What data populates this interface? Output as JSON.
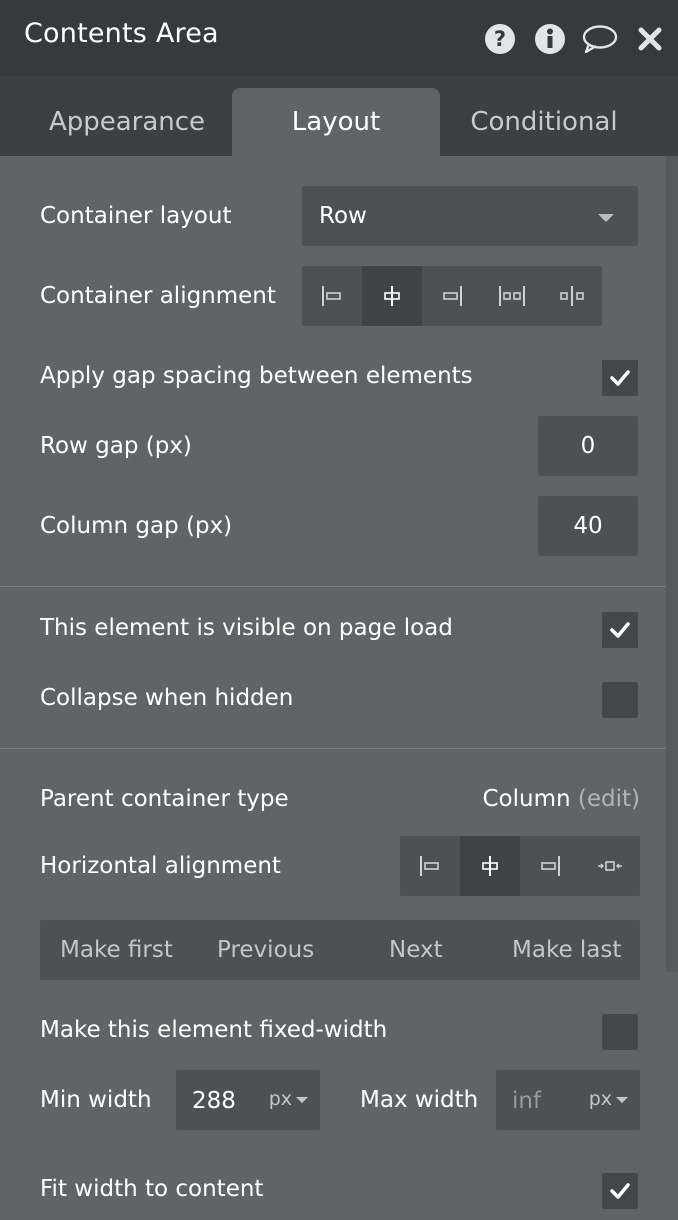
{
  "header": {
    "title": "Contents Area",
    "icons": [
      "help-icon",
      "info-icon",
      "comment-icon",
      "close-icon"
    ]
  },
  "tabs": [
    {
      "label": "Appearance",
      "active": false
    },
    {
      "label": "Layout",
      "active": true
    },
    {
      "label": "Conditional",
      "active": false
    }
  ],
  "container": {
    "layout_label": "Container layout",
    "layout_value": "Row",
    "alignment_label": "Container alignment",
    "alignment_options": [
      "align-left-icon",
      "align-center-icon",
      "align-right-icon",
      "space-between-icon",
      "space-around-icon"
    ],
    "alignment_selected": 1,
    "gap_label": "Apply gap spacing between elements",
    "gap_checked": true,
    "row_gap_label": "Row gap (px)",
    "row_gap_value": "0",
    "column_gap_label": "Column gap (px)",
    "column_gap_value": "40"
  },
  "visibility": {
    "visible_label": "This element is visible on page load",
    "visible_checked": true,
    "collapse_label": "Collapse when hidden",
    "collapse_checked": false
  },
  "parent": {
    "type_label": "Parent container type",
    "type_value": "Column",
    "edit_label": "(edit)",
    "halign_label": "Horizontal alignment",
    "halign_options": [
      "align-left-icon",
      "align-center-icon",
      "align-right-icon",
      "stretch-icon"
    ],
    "halign_selected": 1,
    "order_buttons": [
      "Make first",
      "Previous",
      "Next",
      "Make last"
    ]
  },
  "width": {
    "fixed_label": "Make this element fixed-width",
    "fixed_checked": false,
    "min_label": "Min width",
    "min_value": "288",
    "min_unit": "px",
    "max_label": "Max width",
    "max_placeholder": "inf",
    "max_unit": "px",
    "fit_label": "Fit width to content",
    "fit_checked": true
  },
  "colors": {
    "panel_bg": "#5f6467",
    "header_bg": "#363a3c",
    "tabbar_bg": "#3c4043",
    "input_bg": "#4c5154",
    "selected_bg": "#3f4346"
  }
}
